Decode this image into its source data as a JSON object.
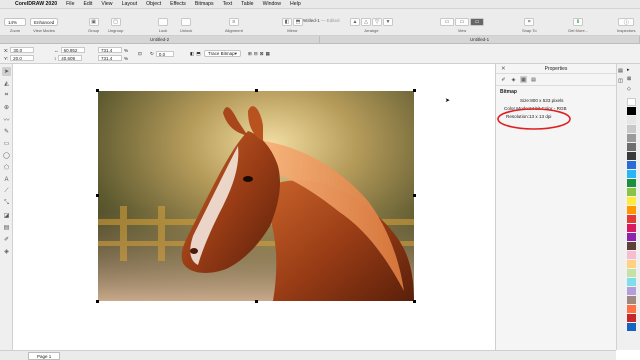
{
  "menubar": {
    "app_name": "CorelDRAW 2020",
    "items": [
      "File",
      "Edit",
      "View",
      "Layout",
      "Object",
      "Effects",
      "Bitmaps",
      "Text",
      "Table",
      "Window",
      "Help"
    ]
  },
  "window": {
    "title": "Untitled-1",
    "edited": "— Edited"
  },
  "toolbar": {
    "zoom_value": "14%",
    "zoom_label": "Zoom",
    "view_mode_value": "Enhanced",
    "view_modes_label": "View Modes",
    "group_label": "Group",
    "ungroup_label": "Ungroup",
    "lock_label": "Lock",
    "unlock_label": "Unlock",
    "alignment_label": "Alignment",
    "mirror_label": "Mirror",
    "arrange_label": "Arrange",
    "view_label": "View",
    "snap_label": "Snap To",
    "get_more_label": "Get More...",
    "inspectors_label": "Inspectors"
  },
  "tabs": [
    "Untitled-2",
    "Untitled-1"
  ],
  "propbar": {
    "x_label": "X:",
    "x_value": "30.0",
    "y_label": "Y:",
    "y_value": "20.0",
    "w_value": "60.952",
    "h_value": "40.609",
    "sx_value": "731.4",
    "sy_value": "731.4",
    "pct1": "%",
    "pct2": "%",
    "angle_value": "0.0",
    "trace_label": "Trace Bitmap"
  },
  "docker": {
    "title": "Properties",
    "section": "Bitmap",
    "size_text": "Size:800 x 533 pixels",
    "color_mode_text": "Color Mode:24 bit Color - RGB",
    "resolution_text": "Resolution:13 x 13 dpi"
  },
  "status": {
    "page_tab": "Page 1"
  },
  "palette_colors": [
    "#ffffff",
    "#000000",
    "#e6e6e6",
    "#c8c8c8",
    "#9a9a9a",
    "#6e6e6e",
    "#3a3a3a",
    "#2a6bd6",
    "#29b6f6",
    "#1e8e3e",
    "#8bc34a",
    "#ffeb3b",
    "#ff9800",
    "#e53935",
    "#d81b60",
    "#8e24aa",
    "#5d4037",
    "#f8bbd0",
    "#ffd180",
    "#c5e1a5",
    "#80deea",
    "#b39ddb",
    "#a1887f",
    "#ff7043",
    "#c62828",
    "#1565c0"
  ],
  "colors": {
    "annotation_circle": "#e02020",
    "accent": "#2a6bd6"
  }
}
